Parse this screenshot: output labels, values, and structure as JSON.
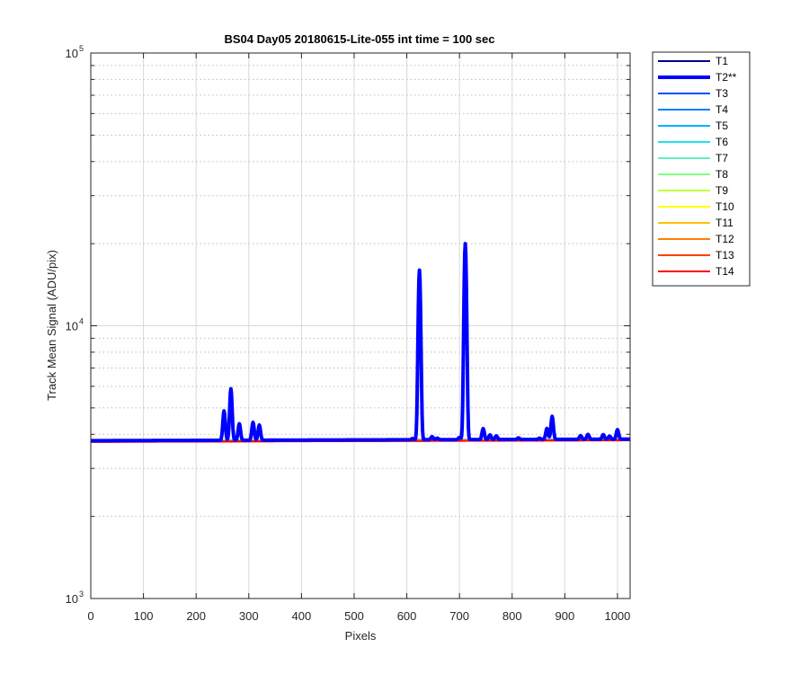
{
  "chart_data": {
    "type": "line",
    "title": "BS04 Day05 20180615-Lite-055 int time = 100 sec",
    "xlabel": "Pixels",
    "ylabel": "Track Mean Signal (ADU/pix)",
    "xlim": [
      0,
      1024
    ],
    "ylim": [
      1000,
      100000
    ],
    "yscale": "log",
    "grid": true,
    "legend_position": "outside-top-right",
    "x_ticks": [
      0,
      100,
      200,
      300,
      400,
      500,
      600,
      700,
      800,
      900,
      1000
    ],
    "x_tick_labels": [
      "0",
      "100",
      "200",
      "300",
      "400",
      "500",
      "600",
      "700",
      "800",
      "900",
      "1000"
    ],
    "y_tick_labels": [
      {
        "value": 1000,
        "base": "10",
        "exp": "3"
      },
      {
        "value": 10000,
        "base": "10",
        "exp": "4"
      },
      {
        "value": 100000,
        "base": "10",
        "exp": "5"
      }
    ],
    "series": [
      {
        "name": "T1",
        "color": "#00008f",
        "width": 2,
        "baseline": [
          3780,
          3830
        ]
      },
      {
        "name": "T2**",
        "color": "#0000ff",
        "width": 4,
        "baseline": [
          3790,
          3840
        ],
        "peaks": [
          [
            253,
            4900
          ],
          [
            266,
            5900
          ],
          [
            282,
            4400
          ],
          [
            308,
            4450
          ],
          [
            320,
            4350
          ],
          [
            611,
            3870
          ],
          [
            624,
            16000
          ],
          [
            648,
            3930
          ],
          [
            658,
            3880
          ],
          [
            700,
            3900
          ],
          [
            711,
            20000
          ],
          [
            745,
            4200
          ],
          [
            758,
            3980
          ],
          [
            770,
            3950
          ],
          [
            812,
            3880
          ],
          [
            852,
            3870
          ],
          [
            866,
            4200
          ],
          [
            876,
            4650
          ],
          [
            930,
            3950
          ],
          [
            944,
            3990
          ],
          [
            973,
            3980
          ],
          [
            985,
            3930
          ],
          [
            1000,
            4150
          ]
        ]
      },
      {
        "name": "T3",
        "color": "#0050ff",
        "width": 2,
        "baseline": [
          3775,
          3825
        ]
      },
      {
        "name": "T4",
        "color": "#0080ff",
        "width": 2,
        "baseline": [
          3770,
          3822
        ]
      },
      {
        "name": "T5",
        "color": "#00b0ff",
        "width": 2,
        "baseline": [
          3768,
          3820
        ]
      },
      {
        "name": "T6",
        "color": "#20e0f0",
        "width": 2,
        "baseline": [
          3766,
          3818
        ]
      },
      {
        "name": "T7",
        "color": "#60f0c0",
        "width": 2,
        "baseline": [
          3764,
          3816
        ]
      },
      {
        "name": "T8",
        "color": "#80ff80",
        "width": 2,
        "baseline": [
          3762,
          3814
        ]
      },
      {
        "name": "T9",
        "color": "#c0ff40",
        "width": 2,
        "baseline": [
          3760,
          3812
        ]
      },
      {
        "name": "T10",
        "color": "#ffff00",
        "width": 2,
        "baseline": [
          3758,
          3810
        ]
      },
      {
        "name": "T11",
        "color": "#ffc000",
        "width": 2,
        "baseline": [
          3756,
          3808
        ]
      },
      {
        "name": "T12",
        "color": "#ff8000",
        "width": 2,
        "baseline": [
          3754,
          3806
        ]
      },
      {
        "name": "T13",
        "color": "#ff4000",
        "width": 2,
        "baseline": [
          3752,
          3804
        ]
      },
      {
        "name": "T14",
        "color": "#ff0000",
        "width": 2,
        "baseline": [
          3750,
          3800
        ]
      }
    ]
  }
}
